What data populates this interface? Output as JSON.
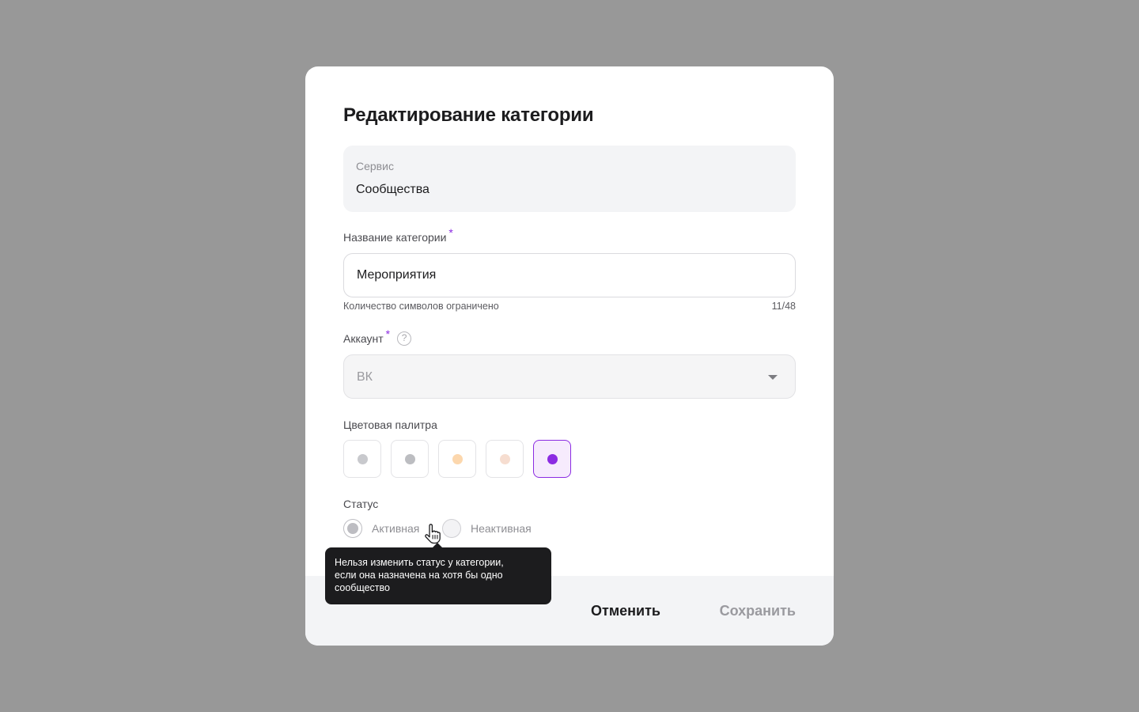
{
  "modal": {
    "title": "Редактирование категории",
    "service": {
      "label": "Сервис",
      "value": "Сообщества"
    },
    "category_name": {
      "label": "Название категории",
      "required_mark": "*",
      "value": "Мероприятия",
      "hint": "Количество символов ограничено",
      "counter": "11/48"
    },
    "account": {
      "label": "Аккаунт",
      "required_mark": "*",
      "help_icon": "question-circle-icon",
      "help_glyph": "?",
      "value": "ВК"
    },
    "palette": {
      "label": "Цветовая палитра",
      "colors": [
        "#c8c9cd",
        "#bcbdc1",
        "#fcd7ad",
        "#f6ddd0",
        "#8b2be2"
      ],
      "selected_index": 4
    },
    "status": {
      "label": "Статус",
      "options": [
        {
          "label": "Активная",
          "checked": true
        },
        {
          "label": "Неактивная",
          "checked": false
        }
      ]
    },
    "tooltip": {
      "lines": [
        "Нельзя изменить статус у категории,",
        "если она назначена на хотя бы одно",
        "сообщество"
      ]
    },
    "footer": {
      "cancel_label": "Отменить",
      "save_label": "Сохранить"
    }
  },
  "colors": {
    "overlay": "#989898",
    "accent": "#8b2be2",
    "tooltip_bg": "#1c1c1e",
    "footer_bg": "#f3f4f6"
  }
}
